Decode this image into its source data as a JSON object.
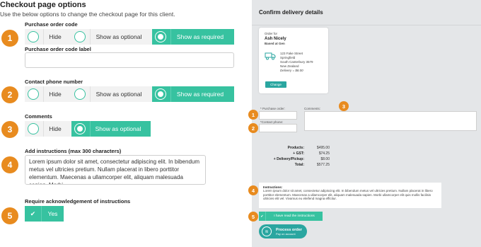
{
  "header": {
    "title": "Checkout page options",
    "subtitle": "Use the below options to change the checkout page for this client."
  },
  "sections": {
    "po_code": {
      "badge": "1",
      "label": "Purchase order code",
      "options": [
        "Hide",
        "Show as optional",
        "Show as required"
      ],
      "selected": "Show as required"
    },
    "po_code_label": {
      "label": "Purchase order code label",
      "value": ""
    },
    "contact_phone": {
      "badge": "2",
      "label": "Contact phone number",
      "options": [
        "Hide",
        "Show as optional",
        "Show as required"
      ],
      "selected": "Show as required"
    },
    "comments": {
      "badge": "3",
      "label": "Comments",
      "options": [
        "Hide",
        "Show as optional"
      ],
      "selected": "Show as optional"
    },
    "instructions": {
      "badge": "4",
      "label": "Add instructions (max 300 characters)",
      "value": "Lorem ipsum dolor sit amet, consectetur adipiscing elit. In bibendum metus vel ultricies pretium. Nullam placerat in libero porttitor elementum. Maecenas a ullamcorper elit, aliquam malesuada sapien. Morbi"
    },
    "ack": {
      "badge": "5",
      "label": "Require acknowledgement of instructions",
      "check": "✔",
      "value": "Yes"
    }
  },
  "preview": {
    "title": "Confirm delivery details",
    "order_for_label": "Order for",
    "name": "Ash Nicely",
    "company": "Based at Gen",
    "address": [
      "123 Fake Street",
      "Springfield",
      "South Canterbury 3579",
      "New Zealand"
    ],
    "delivery": "Delivery = $8.00",
    "change_label": "Change",
    "po_label": "* Purchase order:",
    "phone_label": "*Contact phone:",
    "comments_label": "Comments:",
    "badges": [
      "1",
      "2",
      "3",
      "4",
      "5"
    ],
    "totals": [
      {
        "k": "Products:",
        "v": "$495.00"
      },
      {
        "k": "+ GST:",
        "v": "$74.25"
      },
      {
        "k": "+ Delivery/Pickup:",
        "v": "$8.00"
      },
      {
        "k": "Total:",
        "v": "$577.25"
      }
    ],
    "instructions_heading": "Instructions:",
    "instructions_text": "Lorem ipsum dolor sit amet, consectetur adipiscing elit. In bibendum metus vel ultricies pretium. Nullam placerat in libero porttitor elementum. Maecenas a ullamcorper elit, aliquam malesuada sapien. Morbi ullamcorper elit quis mollis facilisis ultricies elit vel. Vivamus eu eleifend magna efficitur.",
    "ack_check": "✔",
    "ack_label": "I have read the instructions",
    "process_label": "Process order",
    "process_sub": "Pay on account",
    "process_icon": "≋"
  },
  "colors": {
    "accent": "#37c2a0",
    "badge": "#e88b1f",
    "panel": "#e4e6e8",
    "button_dark": "#2aa6a0"
  },
  "icons": [
    "truck-icon",
    "check-icon",
    "process-icon"
  ]
}
